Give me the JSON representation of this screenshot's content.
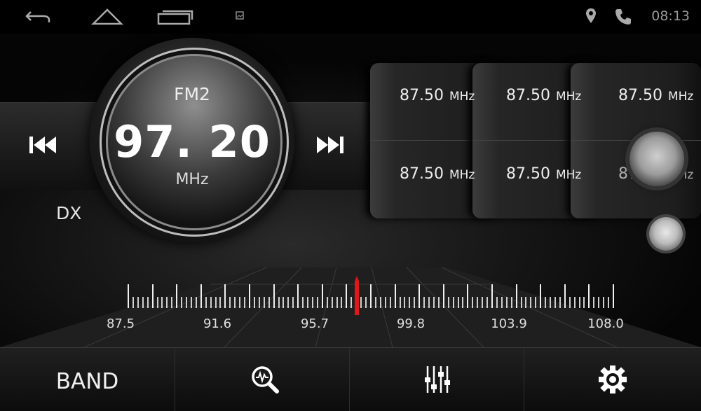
{
  "status_bar": {
    "time": "08:13",
    "icons": [
      "back-icon",
      "home-icon",
      "recent-apps-icon",
      "screenshot-icon",
      "location-icon",
      "phone-icon"
    ]
  },
  "radio": {
    "band": "FM2",
    "frequency": "97. 20",
    "unit": "MHz",
    "dx_label": "DX"
  },
  "presets": [
    {
      "freq": "87.50",
      "unit": "MHz"
    },
    {
      "freq": "87.50",
      "unit": "MHz"
    },
    {
      "freq": "87.50",
      "unit": "MHz"
    },
    {
      "freq": "87.50",
      "unit": "MHz"
    },
    {
      "freq": "87.50",
      "unit": "MHz"
    },
    {
      "freq": "87.50",
      "unit": "MHz"
    }
  ],
  "tuner": {
    "scale_labels": [
      "87.5",
      "91.6",
      "95.7",
      "99.8",
      "103.9",
      "108.0"
    ],
    "min": 87.5,
    "max": 108.0,
    "current": 97.2,
    "needle_color": "#e01818"
  },
  "bottom_bar": {
    "band_label": "BAND",
    "buttons": [
      "band-button",
      "scan-button",
      "equalizer-button",
      "settings-button"
    ]
  },
  "colors": {
    "background": "#000000",
    "text": "#eeeeee"
  }
}
